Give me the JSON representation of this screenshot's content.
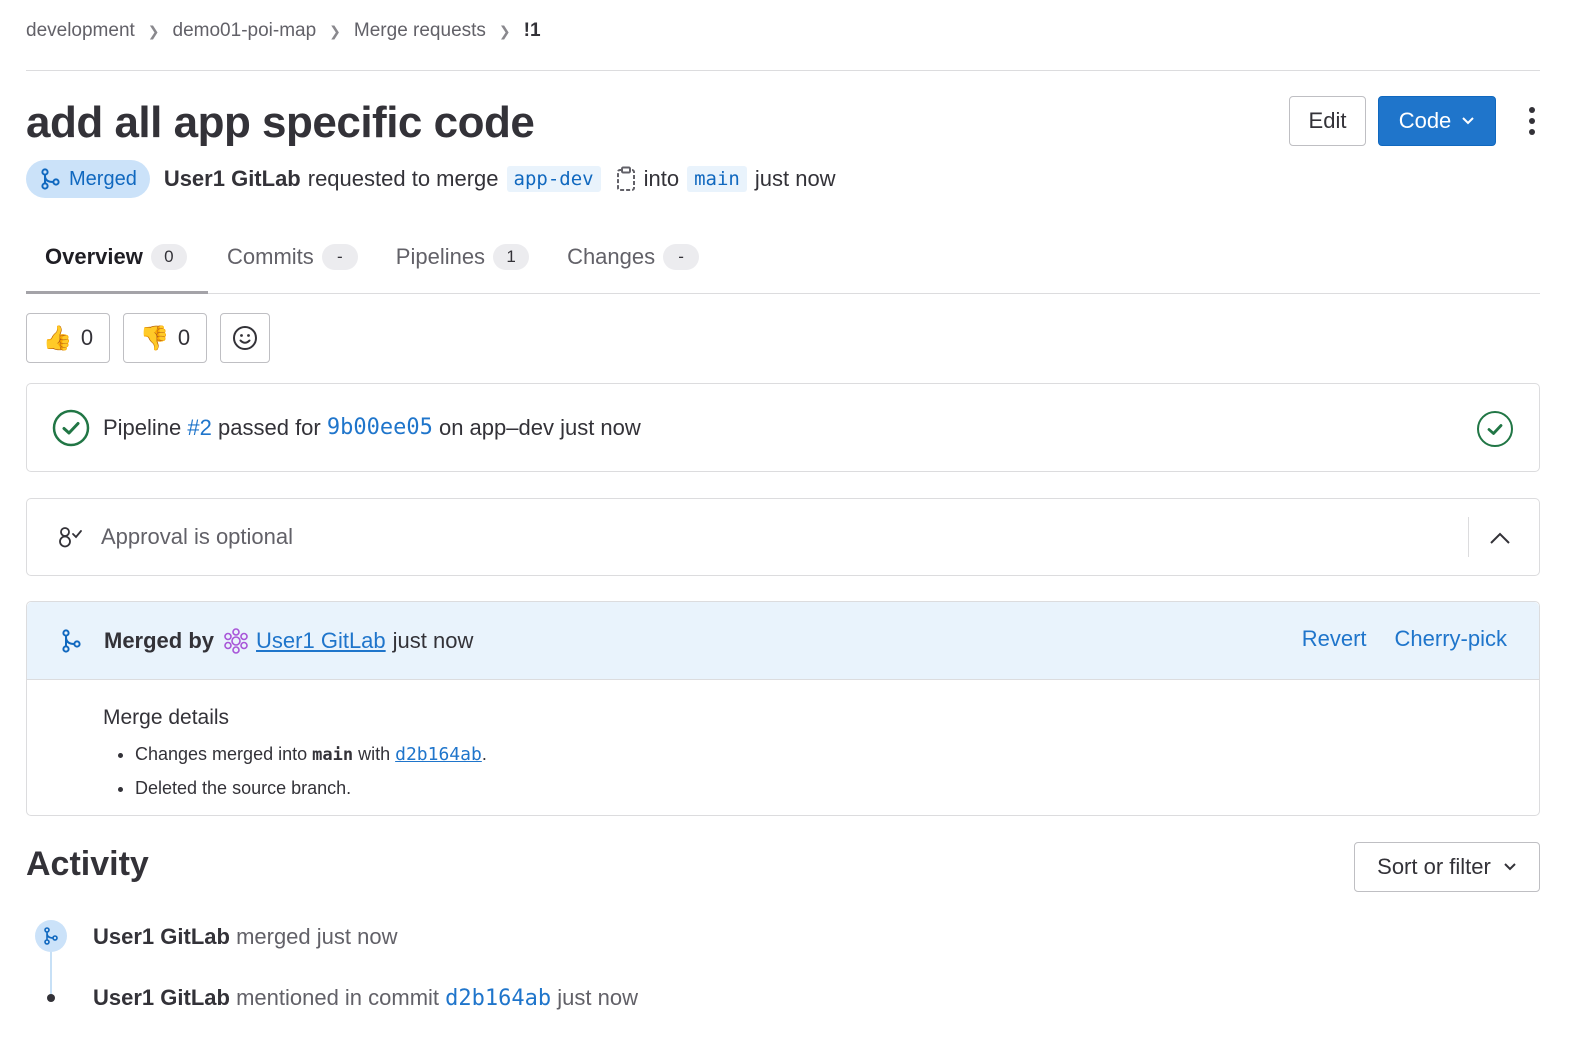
{
  "breadcrumb": {
    "items": [
      "development",
      "demo01-poi-map",
      "Merge requests",
      "!1"
    ]
  },
  "header": {
    "title": "add all app specific code",
    "edit_label": "Edit",
    "code_label": "Code"
  },
  "meta": {
    "status": "Merged",
    "author": "User1 GitLab",
    "requested_text": "requested to merge",
    "source_branch": "app-dev",
    "into_text": "into",
    "target_branch": "main",
    "time": "just now"
  },
  "tabs": [
    {
      "label": "Overview",
      "count": "0"
    },
    {
      "label": "Commits",
      "count": "-"
    },
    {
      "label": "Pipelines",
      "count": "1"
    },
    {
      "label": "Changes",
      "count": "-"
    }
  ],
  "reactions": {
    "thumbs_up_emoji": "👍",
    "thumbs_up_count": "0",
    "thumbs_down_emoji": "👎",
    "thumbs_down_count": "0"
  },
  "pipeline": {
    "prefix": "Pipeline",
    "id": "#2",
    "passed_for": "passed for",
    "commit": "9b00ee05",
    "suffix": "on app–dev just now"
  },
  "approval": {
    "text": "Approval is optional"
  },
  "merged": {
    "by_label": "Merged by",
    "user": "User1 GitLab",
    "time": "just now",
    "revert_label": "Revert",
    "cherry_pick_label": "Cherry-pick",
    "details_title": "Merge details",
    "detail_1_prefix": "Changes merged into",
    "detail_1_branch": "main",
    "detail_1_with": "with",
    "detail_1_commit": "d2b164ab",
    "detail_1_end": ".",
    "detail_2": "Deleted the source branch."
  },
  "activity": {
    "title": "Activity",
    "sort_label": "Sort or filter",
    "items": [
      {
        "user": "User1 GitLab",
        "text": "merged just now"
      },
      {
        "user": "User1 GitLab",
        "text": "mentioned in commit",
        "commit": "d2b164ab",
        "time": "just now"
      }
    ]
  },
  "colors": {
    "accent": "#1f75cb",
    "merged_bg": "#cbe2f9",
    "success": "#217645"
  }
}
